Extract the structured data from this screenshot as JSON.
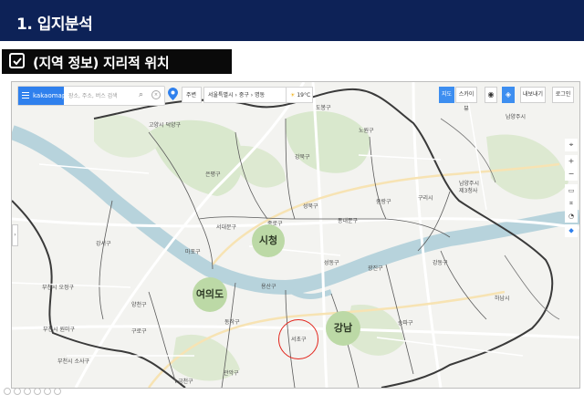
{
  "header": {
    "title": "1. 입지분석"
  },
  "section": {
    "label": "(지역 정보) 지리적 위치"
  },
  "map": {
    "logo": "kakaomap",
    "search_placeholder": "장소, 주소, 버스 검색",
    "chips": {
      "around": "주변",
      "region": "서울특별시",
      "district": "중구",
      "dong": "명동",
      "weather": "19°C"
    },
    "buttons": {
      "map": "지도",
      "skyview": "스카이뷰",
      "directions": "내보내기",
      "login": "로그인"
    },
    "markers": {
      "city_hall": "시청",
      "yeouido": "여의도",
      "gangnam": "강남"
    },
    "labels": {
      "goyang": "고양시 덕양구",
      "dobong": "도봉구",
      "nowon": "노원구",
      "gangbuk": "강북구",
      "eunpyeong": "은평구",
      "seongbuk": "성북구",
      "jungnang": "중랑구",
      "guri": "구리시",
      "namyangju_n": "남양주시",
      "namyangju": "남양주시\n제3청사",
      "seodaemun": "서대문구",
      "jongno": "종로구",
      "dongdaemun": "동대문구",
      "gangseo": "강서구",
      "mapo": "마포구",
      "seongdong": "성동구",
      "gwangjin": "광진구",
      "gangdong": "강동구",
      "bucheon_ojeong": "부천시 오정구",
      "yangcheon": "양천구",
      "yongsan": "용산구",
      "guro": "구로구",
      "dongjak": "동작구",
      "songpa": "송파구",
      "hanam": "하남시",
      "bucheon_wonmi": "부천시 원미구",
      "seocho": "서초구",
      "bucheon_sosa": "부천시 소사구",
      "gwanak": "관악구",
      "geumcheon": "금천구"
    }
  },
  "colors": {
    "header_bg": "#0d2257",
    "section_bg": "#0a0a0a",
    "marker_fill": "#bcd9a6",
    "ring": "#e2231a",
    "river": "#b7d3dc",
    "park": "#d9e8cd",
    "accent": "#3d8ef0"
  }
}
